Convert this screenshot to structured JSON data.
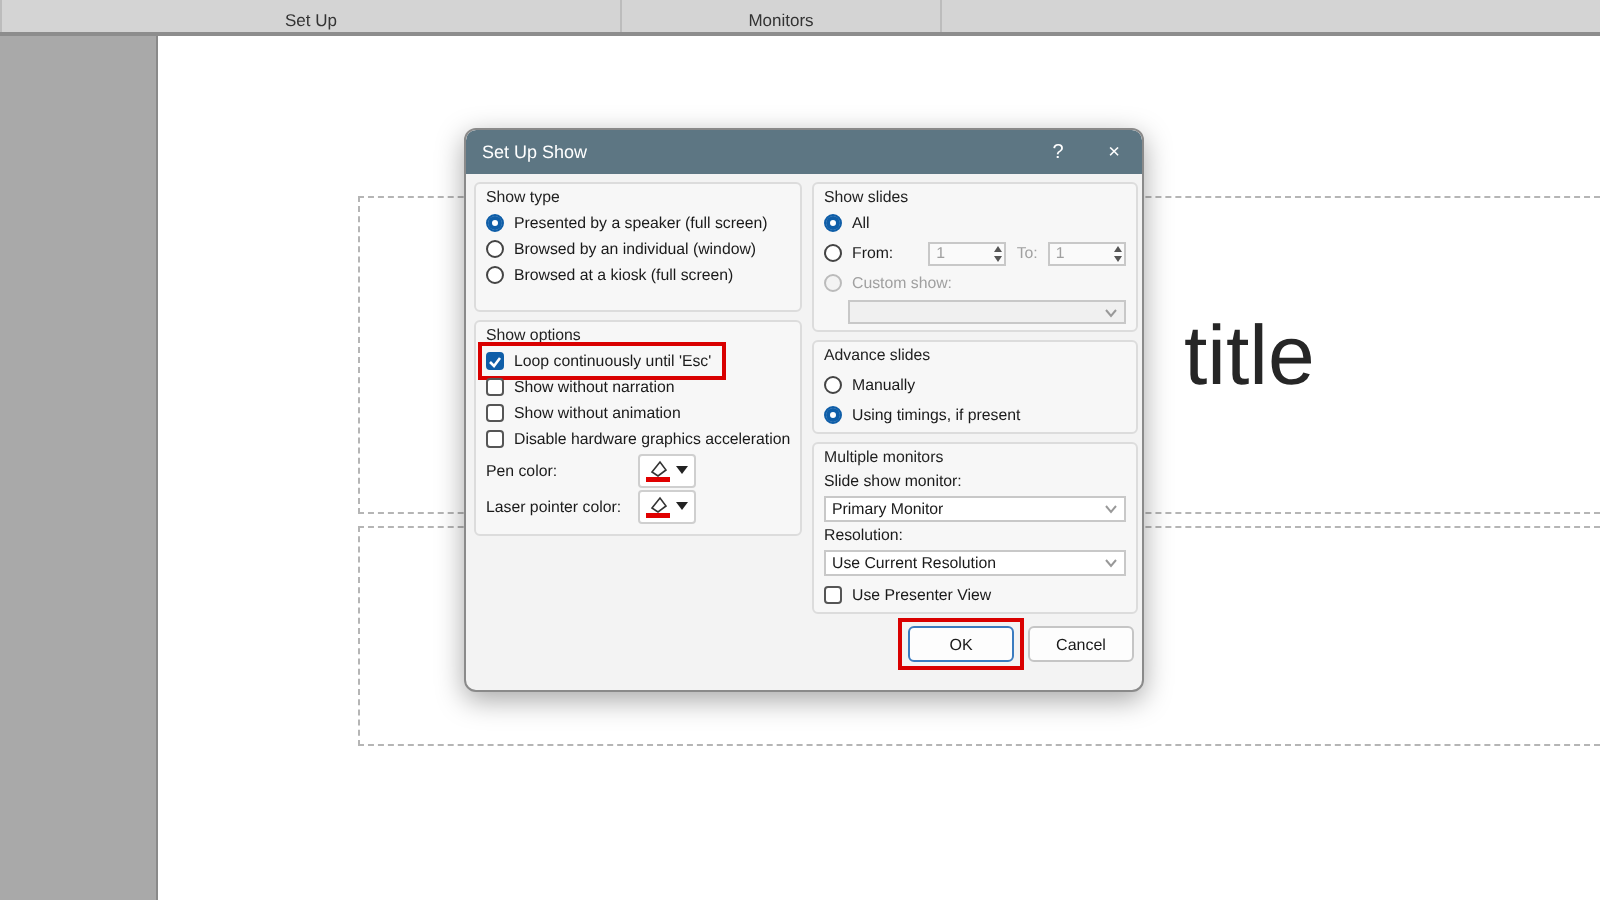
{
  "ribbon": {
    "groups": [
      {
        "label": "Set Up"
      },
      {
        "label": "Monitors"
      }
    ]
  },
  "slide": {
    "placeholders": [
      {
        "kind": "title",
        "text": "title"
      },
      {
        "kind": "subtitle"
      }
    ]
  },
  "dialog": {
    "title": "Set Up Show",
    "help": "?",
    "close": "×",
    "show_type": {
      "label": "Show type",
      "options": [
        {
          "label": "Presented by a speaker (full screen)",
          "selected": true
        },
        {
          "label": "Browsed by an individual (window)",
          "selected": false
        },
        {
          "label": "Browsed at a kiosk (full screen)",
          "selected": false
        }
      ]
    },
    "show_options": {
      "label": "Show options",
      "checkboxes": [
        {
          "label": "Loop continuously until 'Esc'",
          "checked": true,
          "highlighted": true
        },
        {
          "label": "Show without narration",
          "checked": false,
          "highlighted": false
        },
        {
          "label": "Show without animation",
          "checked": false,
          "highlighted": false
        },
        {
          "label": "Disable hardware graphics acceleration",
          "checked": false,
          "highlighted": false
        }
      ],
      "color_pickers": [
        {
          "label": "Pen color:",
          "color": "#e00000"
        },
        {
          "label": "Laser pointer color:",
          "color": "#e00000"
        }
      ]
    },
    "show_slides": {
      "label": "Show slides",
      "options": [
        {
          "kind": "plain",
          "label": "All",
          "selected": true,
          "disabled": false
        },
        {
          "kind": "range",
          "label": "From:",
          "selected": false,
          "disabled": false,
          "from": "1",
          "to_label": "To:",
          "to": "1",
          "range_disabled": true
        },
        {
          "kind": "custom",
          "label": "Custom show:",
          "selected": false,
          "disabled": true
        }
      ]
    },
    "advance_slides": {
      "label": "Advance slides",
      "options": [
        {
          "label": "Manually",
          "selected": false
        },
        {
          "label": "Using timings, if present",
          "selected": true
        }
      ]
    },
    "multiple_monitors": {
      "label": "Multiple monitors",
      "monitor_label": "Slide show monitor:",
      "monitor": "Primary Monitor",
      "resolution_label": "Resolution:",
      "resolution": "Use Current Resolution",
      "presenter_view": {
        "label": "Use Presenter View",
        "checked": false
      }
    },
    "buttons": [
      {
        "label": "OK",
        "highlighted": true
      },
      {
        "label": "Cancel",
        "highlighted": false
      }
    ]
  }
}
